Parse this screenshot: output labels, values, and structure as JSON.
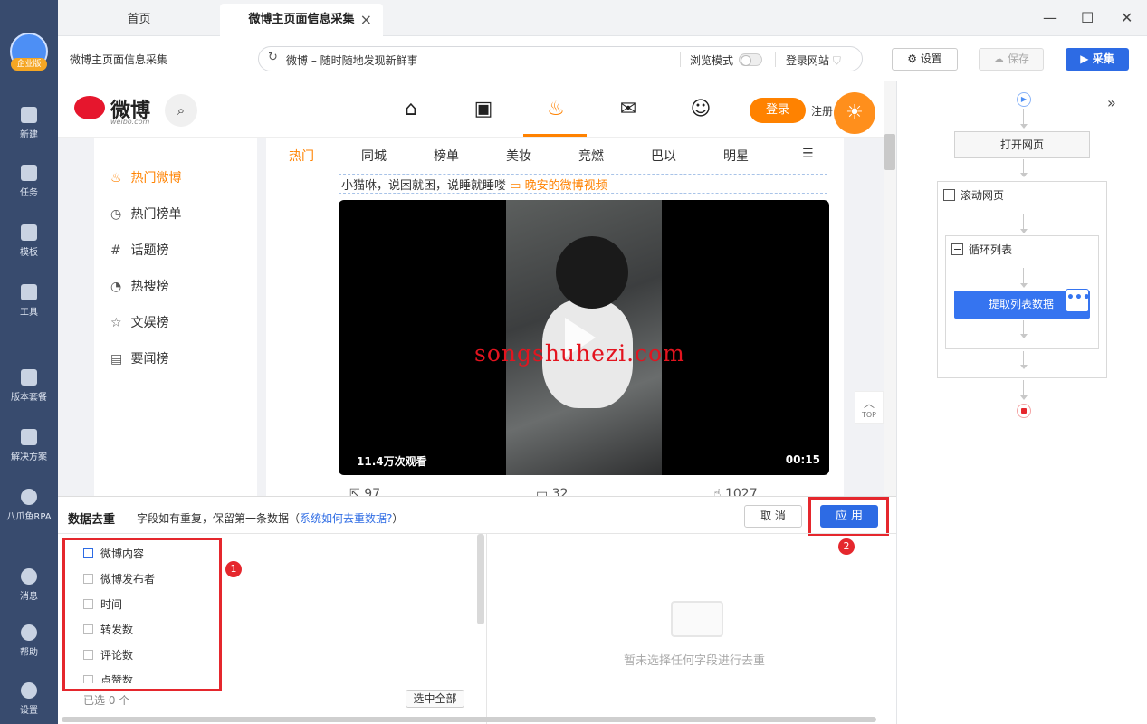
{
  "sidebar": {
    "badge": "企业版",
    "items": [
      {
        "label": "新建",
        "icon": "plus-square-icon"
      },
      {
        "label": "任务",
        "icon": "task-flag-icon"
      },
      {
        "label": "模板",
        "icon": "template-icon"
      },
      {
        "label": "工具",
        "icon": "toolbox-icon"
      },
      {
        "label": "版本套餐",
        "icon": "crown-icon"
      },
      {
        "label": "解决方案",
        "icon": "solution-icon"
      },
      {
        "label": "八爪鱼RPA",
        "icon": "octopus-icon"
      },
      {
        "label": "消息",
        "icon": "bell-icon"
      },
      {
        "label": "帮助",
        "icon": "help-icon"
      },
      {
        "label": "设置",
        "icon": "gear-icon"
      }
    ]
  },
  "tabs": [
    {
      "label": "首页"
    },
    {
      "label": "微博主页面信息采集"
    }
  ],
  "window": {
    "minimize": "—",
    "maximize": "☐",
    "close": "✕"
  },
  "toolbar": {
    "task_title": "微博主页面信息采集",
    "url": "微博 – 随时随地发现新鲜事",
    "browse_mode": "浏览模式",
    "login_site": "登录网站",
    "settings": "设置",
    "save": "保存",
    "collect": "采集"
  },
  "weibo": {
    "logo": "微博",
    "logo_sub": "weibo.com",
    "login_button": "登录",
    "register": "注册",
    "menu": [
      {
        "label": "热门微博",
        "icon": "fire-icon",
        "active": true
      },
      {
        "label": "热门榜单",
        "icon": "clock-icon"
      },
      {
        "label": "话题榜",
        "icon": "hash-icon"
      },
      {
        "label": "热搜榜",
        "icon": "search-circle-icon"
      },
      {
        "label": "文娱榜",
        "icon": "star-icon"
      },
      {
        "label": "要闻榜",
        "icon": "news-icon"
      }
    ],
    "categories": [
      "热门",
      "同城",
      "榜单",
      "美妆",
      "竞燃",
      "巴以",
      "明星"
    ],
    "post": {
      "text": "小猫咻，说困就困，说睡就睡喽",
      "link": "晚安的微博视频",
      "views": "11.4万次观看",
      "duration": "00:15",
      "watermark": "songshuhezi.com",
      "reposts": "97",
      "comments": "32",
      "likes": "1027"
    },
    "top_label": "TOP"
  },
  "dedup": {
    "title": "数据去重",
    "desc_prefix": "字段如有重复，保留第一条数据（",
    "desc_link": "系统如何去重数据?",
    "desc_suffix": "）",
    "cancel": "取 消",
    "apply": "应 用",
    "fields": [
      "微博内容",
      "微博发布者",
      "时间",
      "转发数",
      "评论数",
      "点赞数"
    ],
    "selected_count": "已选 0 个",
    "select_all": "选中全部",
    "empty_text": "暂未选择任何字段进行去重",
    "badge1": "1",
    "badge2": "2"
  },
  "flow": {
    "open_page": "打开网页",
    "scroll_page": "滚动网页",
    "loop_list": "循环列表",
    "extract": "提取列表数据",
    "more": "•••"
  },
  "colors": {
    "accent": "#2d6be4",
    "weibo_orange": "#ff8200",
    "highlight_red": "#e5272d",
    "sidebar_bg": "#384b6e"
  }
}
